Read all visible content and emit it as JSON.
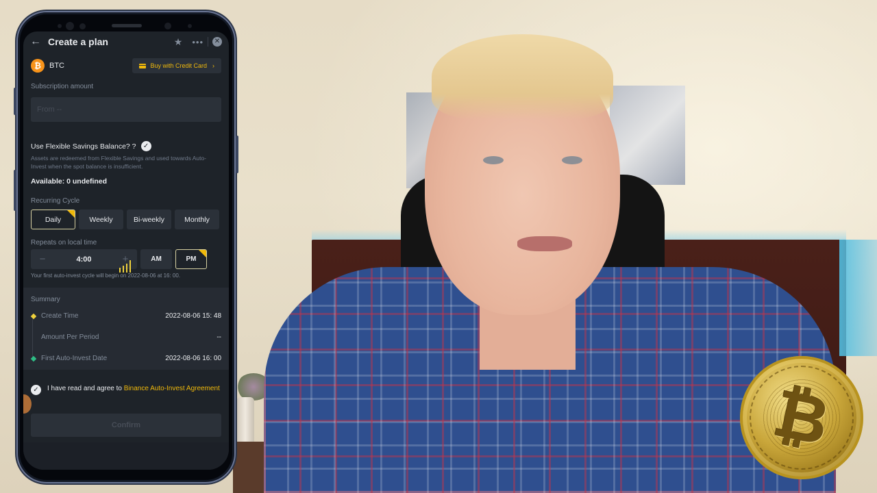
{
  "screen": {
    "nav": {
      "title": "Create a plan",
      "icons": {
        "back": "arrow-left",
        "favorite": "star",
        "more": "ellipsis",
        "close": "close-circle"
      }
    },
    "asset": {
      "symbol": "BTC",
      "icon": "bitcoin-logo",
      "buy_button_label": "Buy with Credit Card",
      "buy_button_icon": "credit-card"
    },
    "subscription": {
      "label": "Subscription amount",
      "placeholder": "From --",
      "value": ""
    },
    "flexible_savings": {
      "label": "Use Flexible Savings Balance? ?",
      "checked": true,
      "description": "Assets are redeemed from Flexible Savings and used towards Auto-Invest when the spot balance is insufficient.",
      "available": "Available: 0 undefined"
    },
    "recurring_cycle": {
      "label": "Recurring Cycle",
      "options": [
        "Daily",
        "Weekly",
        "Bi-weekly",
        "Monthly"
      ],
      "selected": "Daily"
    },
    "repeat_time": {
      "label": "Repeats on local time",
      "minus": "−",
      "value": "4:00",
      "plus": "+",
      "am_label": "AM",
      "pm_label": "PM",
      "selected_period": "PM",
      "note": "Your first auto-invest cycle will begin on 2022-08-06 at 16: 00."
    },
    "summary": {
      "title": "Summary",
      "rows": [
        {
          "key": "Create Time",
          "value": "2022-08-06 15: 48",
          "marker_color": "#f0d23c"
        },
        {
          "key": "Amount Per Period",
          "value": "--",
          "marker_color": ""
        },
        {
          "key": "First Auto-Invest Date",
          "value": "2022-08-06 16: 00",
          "marker_color": "#2ebd85"
        }
      ]
    },
    "agreement": {
      "checked": true,
      "prefix": "I have read and agree to ",
      "link_text": "Binance Auto-Invest Agreement"
    },
    "confirm_label": "Confirm"
  },
  "overlay": {
    "coin_symbol": "₿"
  },
  "colors": {
    "accent": "#f0b90b",
    "background": "#1e2329",
    "surface": "#2b3139",
    "text_primary": "#eaecef",
    "text_secondary": "#848e9c"
  }
}
